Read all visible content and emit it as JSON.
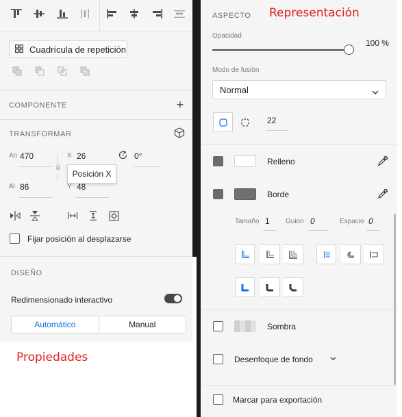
{
  "left": {
    "align_icons": [
      "align-top-icon",
      "align-middle-icon",
      "align-bottom-icon",
      "distribute-vertical-icon",
      "align-left-icon",
      "align-center-icon",
      "align-right-icon",
      "distribute-horizontal-icon"
    ],
    "repeat_grid_label": "Cuadrícula de repetición",
    "boolean_icons": [
      "union-icon",
      "subtract-icon",
      "intersect-icon",
      "exclude-icon"
    ],
    "component": {
      "title": "COMPONENTE",
      "add": "+"
    },
    "transform": {
      "title": "TRANSFORMAR",
      "width_label": "An",
      "width_value": "470",
      "height_label": "Al",
      "height_value": "86",
      "x_label": "X",
      "x_value": "26",
      "y_label": "Y",
      "y_value": "48",
      "rotation_value": "0°",
      "tooltip": "Posición X",
      "fix_position_label": "Fijar posición al desplazarse"
    },
    "design": {
      "title": "DISEÑO",
      "responsive_label": "Redimensionado interactivo",
      "tab_auto": "Automático",
      "tab_manual": "Manual"
    }
  },
  "annotations": {
    "left_label": "Propiedades",
    "right_label": "Representación"
  },
  "right": {
    "appearance_title": "ASPECTO",
    "opacity_label": "Opacidad",
    "opacity_value": "100 %",
    "opacity_level": 1.0,
    "blend_label": "Modo de fusión",
    "blend_value": "Normal",
    "corner_radius": "22",
    "fill_label": "Relleno",
    "border_label": "Borde",
    "border_size_label": "Tamaño",
    "border_size_value": "1",
    "dash_label": "Guion",
    "dash_value": "0",
    "gap_label": "Espacio",
    "gap_value": "0",
    "shadow_label": "Sombra",
    "bg_blur_label": "Desenfoque de fondo",
    "export_label": "Marcar para exportación"
  },
  "colors": {
    "accent": "#1473e6",
    "annotation_red": "#e0201c",
    "panel_bg": "#f5f5f5",
    "divider_bar": "#1c1c1c",
    "fill_swatch": "#ffffff",
    "border_swatch": "#707070"
  }
}
